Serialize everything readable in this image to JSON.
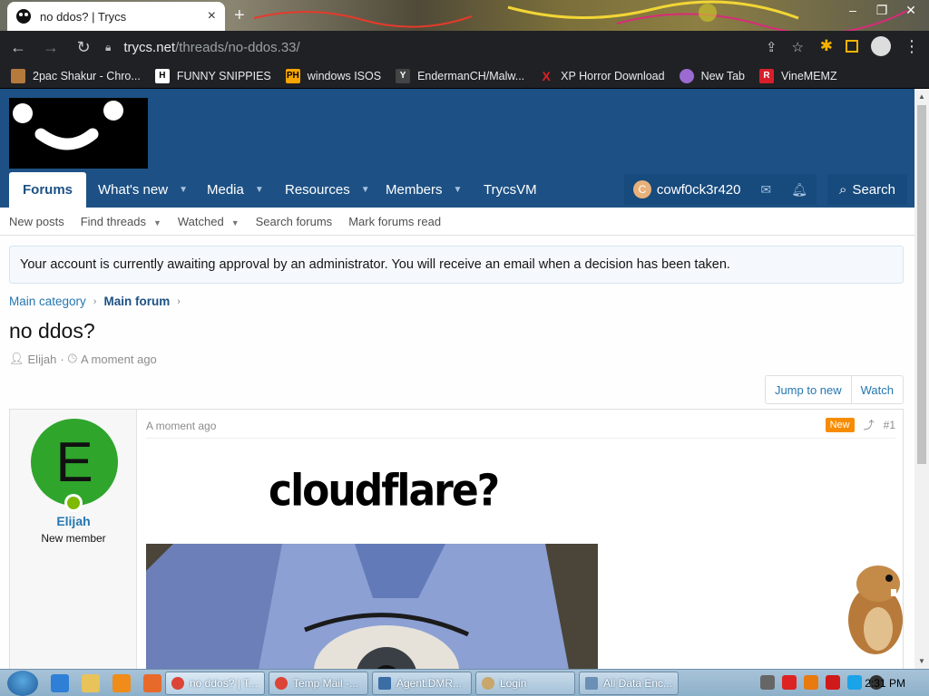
{
  "browser": {
    "tab_title": "no ddos? | Trycs",
    "tab_close": "×",
    "new_tab": "+",
    "window_controls": [
      "–",
      "❐",
      "✕"
    ],
    "url_host": "trycs.net",
    "url_path": "/threads/no-ddos.33/",
    "bookmarks": [
      {
        "label": "2pac Shakur - Chro...",
        "icon": "bear-icon",
        "color": "#b57a3c"
      },
      {
        "label": "FUNNY SNIPPIES",
        "icon": "H",
        "color": "#ffffff"
      },
      {
        "label": "windows ISOS",
        "icon": "PH",
        "color": "#f7a500"
      },
      {
        "label": "EndermanCH/Malw...",
        "icon": "Y",
        "color": "#444444"
      },
      {
        "label": "XP Horror Download",
        "icon": "X",
        "color": "#e02020"
      },
      {
        "label": "New Tab",
        "icon": "globe-icon",
        "color": "#9b6bd1"
      },
      {
        "label": "VineMEMZ",
        "icon": "R",
        "color": "#d81e2a"
      }
    ]
  },
  "site": {
    "nav": {
      "forums": "Forums",
      "whats_new": "What's new",
      "media": "Media",
      "resources": "Resources",
      "members": "Members",
      "trycsvm": "TrycsVM"
    },
    "user": {
      "initial": "C",
      "name": "cowf0ck3r420"
    },
    "search_label": "Search",
    "subnav": {
      "new_posts": "New posts",
      "find_threads": "Find threads",
      "watched": "Watched",
      "search_forums": "Search forums",
      "mark_read": "Mark forums read"
    },
    "notice": "Your account is currently awaiting approval by an administrator. You will receive an email when a decision has been taken.",
    "breadcrumb": {
      "main_category": "Main category",
      "main_forum": "Main forum"
    },
    "thread": {
      "title": "no ddos?",
      "author": "Elijah",
      "time": "A moment ago",
      "jump_to_new": "Jump to new",
      "watch": "Watch"
    },
    "post": {
      "avatar_letter": "E",
      "username": "Elijah",
      "user_title": "New member",
      "time": "A moment ago",
      "badge": "New",
      "number": "#1",
      "image_text": "cloudflare?"
    }
  },
  "taskbar": {
    "buttons": [
      {
        "label": "no ddos? | T...",
        "color": "#db4437"
      },
      {
        "label": "Temp Mail -...",
        "color": "#db4437"
      },
      {
        "label": "Agent.DMR...",
        "color": "#3b6ea5"
      },
      {
        "label": "Login",
        "color": "#c9a66b"
      },
      {
        "label": "All Data Enc...",
        "color": "#6b8fb5"
      }
    ],
    "clock": "2:31 PM"
  }
}
